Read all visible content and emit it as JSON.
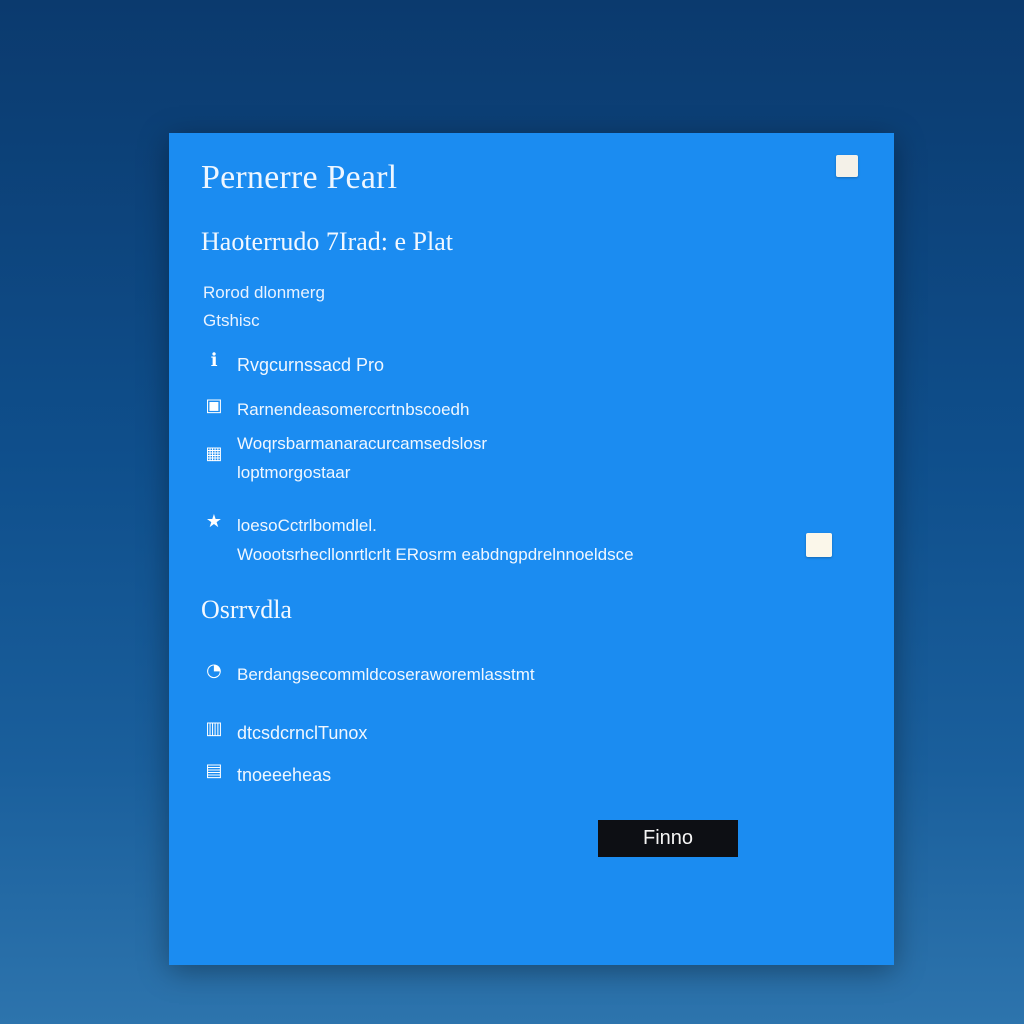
{
  "dialog": {
    "title": "Pernerre Pearl",
    "heading_1": "Haoterrudo 7Irad: e Plat",
    "description": [
      "Rorod dlonmerg",
      "Gtshisc"
    ],
    "options_top": [
      {
        "icon": "info-icon",
        "glyph": "ℹ",
        "lines": [
          "Rvgcurnssacd Pro"
        ]
      },
      {
        "icon": "square-icon",
        "glyph": "▣",
        "lines": [
          "Rarnendeasomerccrtnbscoedh"
        ]
      },
      {
        "icon": "grid-icon",
        "glyph": "▦",
        "lines": [
          "Woqrsbarmanaracurcamsedslosr",
          "loptmorgostaar"
        ]
      },
      {
        "icon": "star-icon",
        "glyph": "★",
        "lines": [
          "loesoCctrlbomdlel.",
          "Woootsrhecllonrtlcrlt ERosrm eabdngpdrelnnoeldsce"
        ]
      }
    ],
    "heading_2": "Osrrvdla",
    "options_bottom": [
      {
        "icon": "clock-icon",
        "glyph": "◔",
        "lines": [
          "Berdangsecommldcoseraworemlasstmt"
        ]
      },
      {
        "icon": "lock-icon",
        "glyph": "▥",
        "lines": [
          "dtcsdcrnclTunox"
        ]
      },
      {
        "icon": "display-icon",
        "glyph": "▤",
        "lines": [
          "tnoeeeheas"
        ]
      }
    ],
    "ok_label": "Finno"
  },
  "colors": {
    "dialog_bg": "#1b8cf1",
    "button_bg": "#0d0f14",
    "desktop_top": "#0b3a6e",
    "desktop_bottom": "#2d74ad"
  }
}
